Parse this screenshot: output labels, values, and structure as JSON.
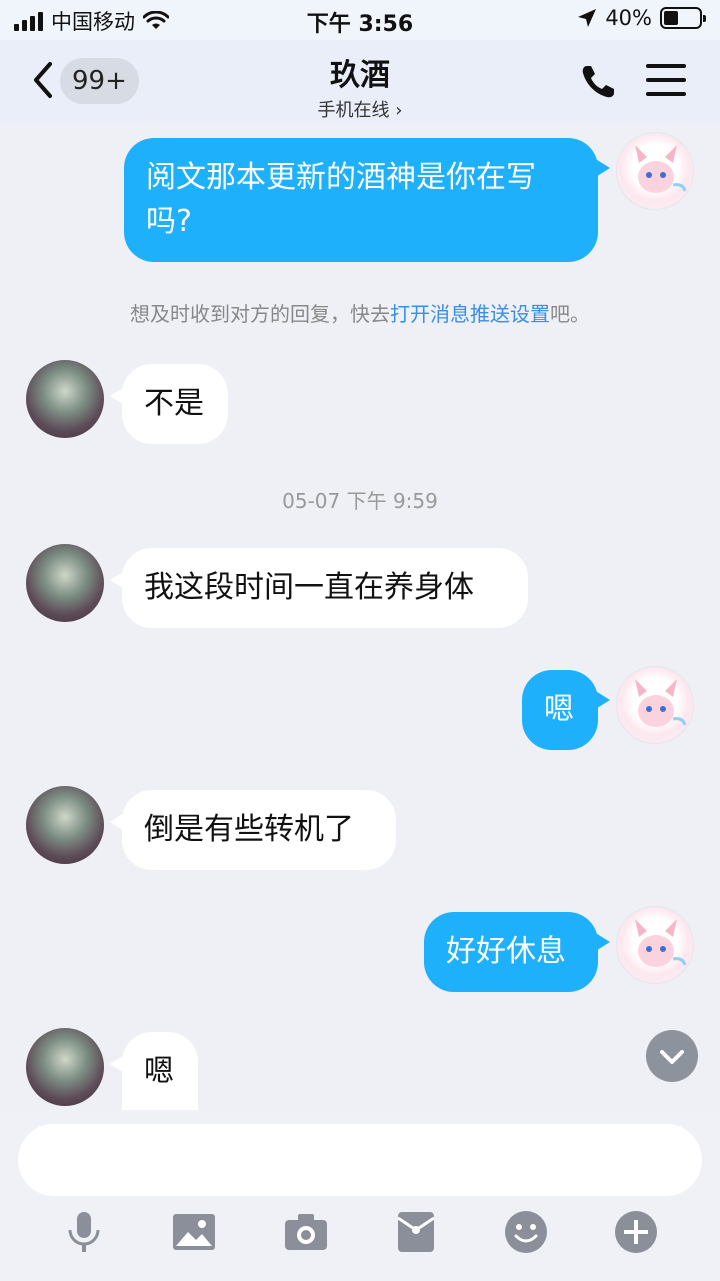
{
  "status_bar": {
    "carrier": "中国移动",
    "time": "下午 3:56",
    "battery": "40%",
    "battery_level": 0.4
  },
  "header": {
    "back_badge": "99+",
    "title": "玖酒",
    "subtitle": "手机在线"
  },
  "messages": [
    {
      "from": "me",
      "text": "阅文那本更新的酒神是你在写吗?"
    },
    {
      "from": "peer",
      "text": "不是"
    },
    {
      "from": "peer",
      "text": "我这段时间一直在养身体"
    },
    {
      "from": "me",
      "text": "嗯"
    },
    {
      "from": "peer",
      "text": "倒是有些转机了"
    },
    {
      "from": "me",
      "text": "好好休息"
    },
    {
      "from": "peer",
      "text": "嗯"
    }
  ],
  "system_note": {
    "prefix": "想及时收到对方的回复，快去",
    "link": "打开消息推送设置",
    "suffix": "吧。"
  },
  "timestamp": "05-07 下午 9:59",
  "toolbar": {
    "icons": [
      "microphone-icon",
      "image-icon",
      "camera-icon",
      "red-packet-icon",
      "emoji-icon",
      "plus-icon"
    ]
  },
  "colors": {
    "my_bubble": "#1eb0fb",
    "peer_bubble": "#ffffff",
    "background": "#eef0f6",
    "link": "#3a8ee6"
  }
}
